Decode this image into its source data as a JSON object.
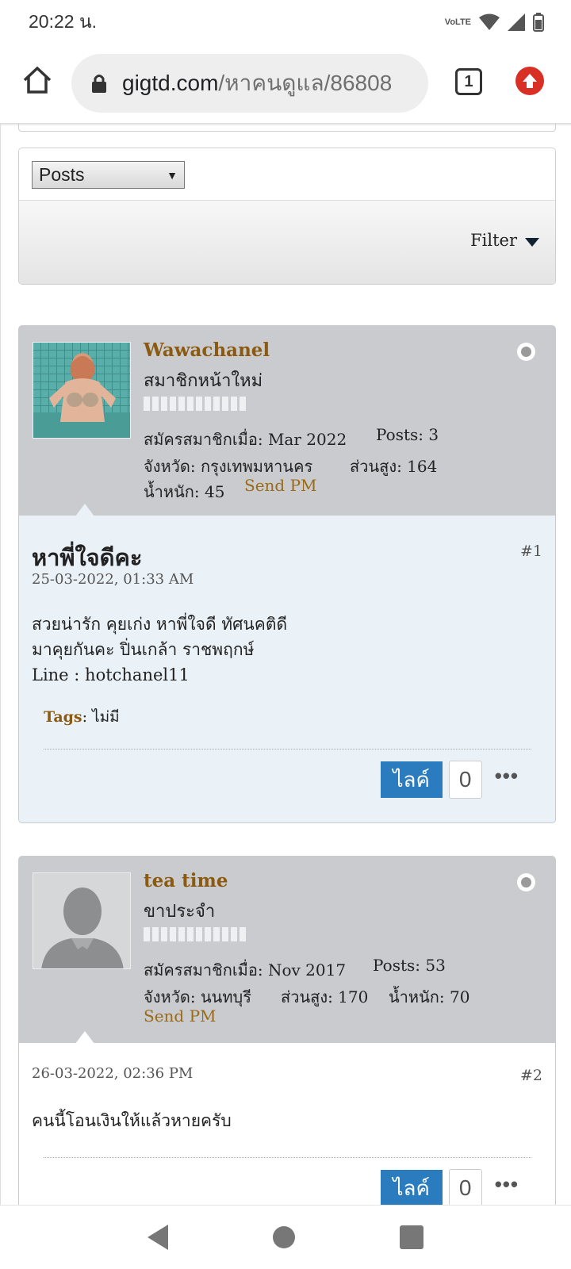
{
  "status": {
    "time": "20:22 น.",
    "network": "VoLTE"
  },
  "browser": {
    "url_host": "gigtd.com",
    "url_path": "/หาคนดูแล/86808",
    "tab_count": "1"
  },
  "filter": {
    "select_value": "Posts",
    "filter_label": "Filter"
  },
  "posts": [
    {
      "username": "Wawachanel",
      "user_title": "สมาชิกหน้าใหม่",
      "joined": "สมัครสมาชิกเมื่อ: Mar 2022",
      "posts": "Posts: 3",
      "province": "จังหวัด: กรุงเทพมหานคร",
      "height": "ส่วนสูง: 164",
      "weight": "น้ำหนัก: 45",
      "send_pm": "Send PM",
      "title": "หาพี่ใจดีคะ",
      "date": "25-03-2022, 01:33 AM",
      "number": "#1",
      "lines": [
        "สวยน่ารัก คุยเก่ง หาพี่ใจดี ทัศนคติดี",
        "มาคุยกันคะ ปิ่นเกล้า ราชพฤกษ์",
        "Line : hotchanel11"
      ],
      "tags_label": "Tags",
      "tags_value": ": ไม่มี",
      "like_label": "ไลค์",
      "like_count": "0"
    },
    {
      "username": "tea time",
      "user_title": "ขาประจำ",
      "joined": "สมัครสมาชิกเมื่อ: Nov 2017",
      "posts": "Posts: 53",
      "province": "จังหวัด: นนทบุรี",
      "height": "ส่วนสูง: 170",
      "weight": "น้ำหนัก: 70",
      "send_pm": "Send PM",
      "date": "26-03-2022, 02:36 PM",
      "number": "#2",
      "lines": [
        "คนนี้โอนเงินให้แล้วหายครับ"
      ],
      "like_label": "ไลค์",
      "like_count": "0"
    }
  ]
}
